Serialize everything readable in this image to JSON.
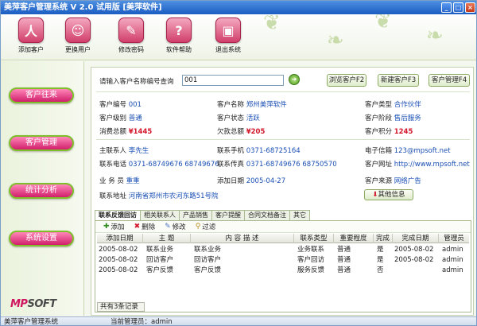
{
  "window": {
    "title": "美萍客户管理系统 V 2.0 试用版 [美萍软件]"
  },
  "toolbar": [
    {
      "label": "添加客户",
      "icon": "add-customer-icon",
      "glyph": "人"
    },
    {
      "label": "更换用户",
      "icon": "switch-user-icon",
      "glyph": "☺"
    },
    {
      "label": "修改密码",
      "icon": "password-icon",
      "glyph": "✎"
    },
    {
      "label": "软件帮助",
      "icon": "help-icon",
      "glyph": "?"
    },
    {
      "label": "退出系统",
      "icon": "exit-icon",
      "glyph": "▣"
    }
  ],
  "sidebar": [
    {
      "label": "客户往来"
    },
    {
      "label": "客户管理"
    },
    {
      "label": "统计分析"
    },
    {
      "label": "系统设置"
    }
  ],
  "logo": {
    "part1": "MP",
    "part2": "SOFT"
  },
  "search": {
    "prompt": "请输入客户名称编号查询",
    "value": "001"
  },
  "buttons": {
    "browse": "浏览客户F2",
    "new": "新建客户F3",
    "manage": "客户管理F4",
    "other": "其他信息"
  },
  "customer": {
    "id_label": "客户编号",
    "id": "001",
    "name_label": "客户名称",
    "name": "郑州美萍软件",
    "type_label": "客户类型",
    "type": "合作伙伴",
    "level_label": "客户级别",
    "level": "普通",
    "status_label": "客户状态",
    "status": "活跃",
    "stage_label": "客户阶段",
    "stage": "售后服务",
    "spend_label": "消费总额",
    "spend": "¥1445",
    "owe_label": "欠款总额",
    "owe": "¥205",
    "points_label": "客户积分",
    "points": "1245",
    "contact_label": "主联系人",
    "contact": "李先生",
    "mobile_label": "联系手机",
    "mobile": "0371-68725164",
    "email_label": "电子信箱",
    "email": "123@mpsoft.net",
    "phone_label": "联系电话",
    "phone": "0371-68749676 68749676",
    "fax_label": "联系传真",
    "fax": "0371-68749676 68750570",
    "web_label": "客户网址",
    "web": "http://www.mpsoft.net",
    "sales_label": "业 务 员",
    "sales": "重重",
    "date_label": "添加日期",
    "date": "2005-04-27",
    "source_label": "客户来源",
    "source": "网络广告",
    "addr_label": "联系地址",
    "addr": "河南省郑州市农河东路51号院"
  },
  "tabs": [
    "联系反馈回访",
    "相关联系人",
    "产品销售",
    "客户提醒",
    "合同文档备注",
    "其它"
  ],
  "subtoolbar": [
    "添加",
    "删除",
    "修改",
    "过滤"
  ],
  "table": {
    "headers": [
      "添加日期",
      "主 题",
      "内 容 描 述",
      "联系类型",
      "重要程度",
      "完成",
      "完成日期",
      "管理员"
    ],
    "rows": [
      [
        "2005-08-02",
        "联系业务",
        "联系业务",
        "业务联系",
        "普通",
        "是",
        "2005-08-02",
        "admin"
      ],
      [
        "2005-08-02",
        "回访客户",
        "回访客户",
        "客户回访",
        "普通",
        "是",
        "2005-08-02",
        "admin"
      ],
      [
        "2005-08-02",
        "客户反馈",
        "客户反馈",
        "服务反馈",
        "普通",
        "否",
        "",
        "admin"
      ]
    ],
    "footer": "共有3条记录"
  },
  "status": {
    "app": "美萍客户管理系统",
    "manager_label": "当前管理员：",
    "manager": "admin"
  }
}
